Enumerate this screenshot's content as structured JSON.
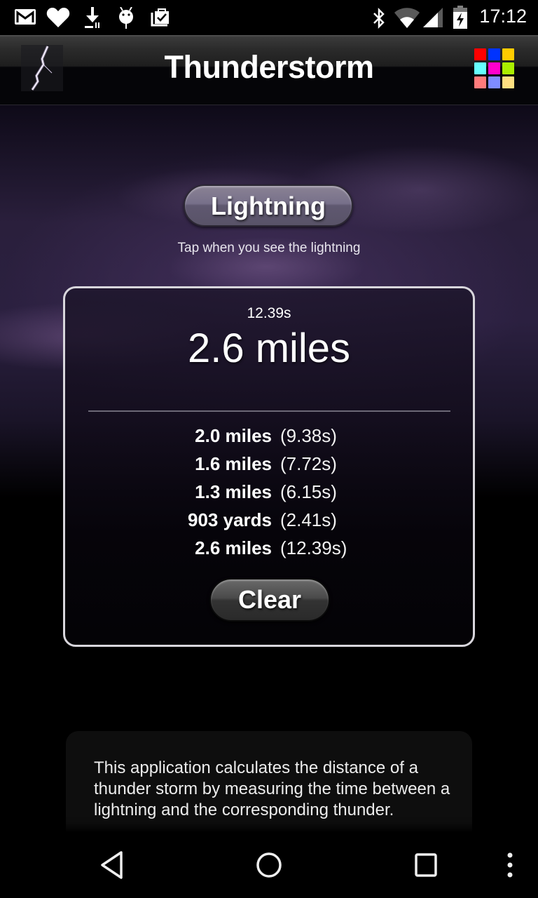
{
  "status_bar": {
    "left_icons": [
      "gmail-icon",
      "heart-icon",
      "download-icon",
      "android-debug-icon",
      "shopping-bag-check-icon"
    ],
    "right_icons": [
      "bluetooth-icon",
      "wifi-icon",
      "cell-signal-icon",
      "battery-charging-icon"
    ],
    "time": "17:12"
  },
  "app_bar": {
    "logo_icon": "lightning-bolt-icon",
    "title": "Thunderstorm",
    "menu_icon": "color-grid-icon",
    "grid_colors": [
      "#ff0000",
      "#0033ff",
      "#ffcc00",
      "#66ffff",
      "#ff00cc",
      "#aaee00",
      "#ff7b7b",
      "#7f8cff",
      "#ffe080"
    ]
  },
  "main": {
    "lightning_button": "Lightning",
    "hint": "Tap when you see the lightning",
    "result": {
      "last_time": "12.39s",
      "last_distance": "2.6 miles"
    },
    "history": [
      {
        "distance": "2.0 miles",
        "time": "(9.38s)"
      },
      {
        "distance": "1.6 miles",
        "time": "(7.72s)"
      },
      {
        "distance": "1.3 miles",
        "time": "(6.15s)"
      },
      {
        "distance": "903 yards",
        "time": "(2.41s)"
      },
      {
        "distance": "2.6 miles",
        "time": "(12.39s)"
      }
    ],
    "clear_button": "Clear"
  },
  "info": {
    "text": "This application calculates the distance of a thunder storm by measuring the time between a lightning and the corresponding thunder."
  },
  "nav_bar": {
    "buttons": [
      "back-icon",
      "home-icon",
      "recents-icon",
      "overflow-menu-icon"
    ]
  }
}
